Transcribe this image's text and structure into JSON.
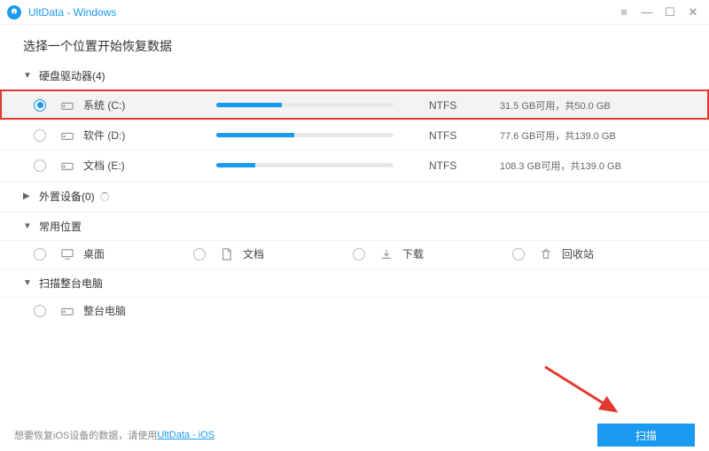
{
  "app": {
    "title": "UltData - Windows"
  },
  "heading": "选择一个位置开始恢复数据",
  "sections": {
    "drives": {
      "label": "硬盘驱动器(4)"
    },
    "external": {
      "label": "外置设备(0)"
    },
    "common": {
      "label": "常用位置"
    },
    "whole": {
      "label": "扫描整台电脑"
    }
  },
  "drives": [
    {
      "name": "系统 (C:)",
      "fs": "NTFS",
      "info": "31.5 GB可用，共50.0 GB",
      "used_pct": 37,
      "selected": true
    },
    {
      "name": "软件 (D:)",
      "fs": "NTFS",
      "info": "77.6 GB可用，共139.0 GB",
      "used_pct": 44,
      "selected": false
    },
    {
      "name": "文档 (E:)",
      "fs": "NTFS",
      "info": "108.3 GB可用，共139.0 GB",
      "used_pct": 22,
      "selected": false
    }
  ],
  "locations": {
    "desktop": "桌面",
    "documents": "文档",
    "downloads": "下载",
    "recycle": "回收站",
    "whole_pc": "整台电脑"
  },
  "footer": {
    "prefix": "想要恢复iOS设备的数据，请使用",
    "link": "UltData - iOS"
  },
  "scan_button": "扫描"
}
